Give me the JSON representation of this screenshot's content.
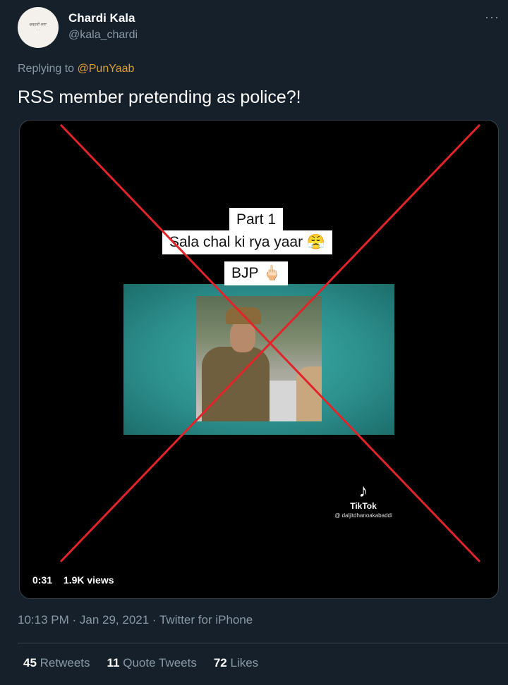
{
  "author": {
    "display_name": "Chardi Kala",
    "handle": "@kala_chardi"
  },
  "menu": {
    "more_icon": "ellipsis-icon",
    "more_glyph": "···"
  },
  "reply": {
    "prefix": "Replying to",
    "mention": "@PunYaab"
  },
  "tweet": {
    "text": "RSS member pretending as police?!"
  },
  "media": {
    "captions": [
      "Part 1",
      "Sala chal ki rya yaar 😤",
      "BJP 🖕🏻"
    ],
    "watermark": {
      "icon": "tiktok-note-icon",
      "glyph": "♪",
      "label": "TikTok",
      "username": "@ daljitdhanoakabaddi"
    },
    "duration": "0:31",
    "views": "1.9K views",
    "overlay_color": "#e0242a"
  },
  "meta": {
    "timestamp": "10:13 PM · Jan 29, 2021 · Twitter for iPhone"
  },
  "stats": {
    "retweets_count": "45",
    "retweets_label": "Retweets",
    "quotes_count": "11",
    "quotes_label": "Quote Tweets",
    "likes_count": "72",
    "likes_label": "Likes"
  }
}
